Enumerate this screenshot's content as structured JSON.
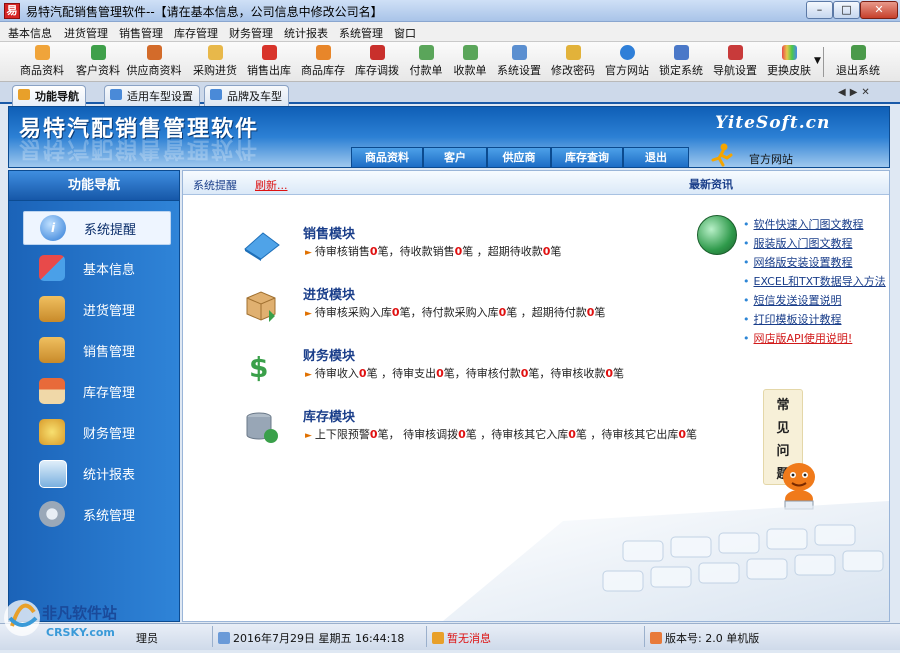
{
  "window": {
    "title": "易特汽配销售管理软件--【请在基本信息，公司信息中修改公司名】",
    "icon_letter": "易",
    "minimize": "–",
    "maximize": "□",
    "close": "✕"
  },
  "menu": [
    "基本信息",
    "进货管理",
    "销售管理",
    "库存管理",
    "财务管理",
    "统计报表",
    "系统管理",
    "窗口"
  ],
  "toolbar": [
    {
      "label": "商品资料",
      "icon": "goods-icon",
      "color": "#f0a43a"
    },
    {
      "label": "客户资料",
      "icon": "customer-icon",
      "color": "#3fa04a"
    },
    {
      "label": "供应商资料",
      "icon": "supplier-icon",
      "color": "#d36b2a"
    },
    {
      "label": "采购进货",
      "icon": "purchase-icon",
      "color": "#e8b84a"
    },
    {
      "label": "销售出库",
      "icon": "sales-icon",
      "color": "#d8342b"
    },
    {
      "label": "商品库存",
      "icon": "inventory-icon",
      "color": "#e8862a"
    },
    {
      "label": "库存调拨",
      "icon": "transfer-icon",
      "color": "#c9302c"
    },
    {
      "label": "付款单",
      "icon": "payment-icon",
      "color": "#5aa55a"
    },
    {
      "label": "收款单",
      "icon": "receipt-icon",
      "color": "#5aa55a"
    },
    {
      "label": "系统设置",
      "icon": "settings-icon",
      "color": "#5b8fd0"
    },
    {
      "label": "修改密码",
      "icon": "password-icon",
      "color": "#e2b23a"
    },
    {
      "label": "官方网站",
      "icon": "web-icon",
      "color": "#2f7fd8"
    },
    {
      "label": "锁定系统",
      "icon": "lock-icon",
      "color": "#4a78c8"
    },
    {
      "label": "导航设置",
      "icon": "nav-settings-icon",
      "color": "#c83a3a"
    },
    {
      "label": "更换皮肤",
      "icon": "skin-icon",
      "color": "#b84ac8"
    },
    {
      "label": "退出系统",
      "icon": "exit-icon",
      "color": "#4a9a4a"
    }
  ],
  "tabs": [
    {
      "label": "功能导航",
      "active": true
    },
    {
      "label": "适用车型设置",
      "active": false
    },
    {
      "label": "品牌及车型",
      "active": false
    }
  ],
  "tab_nav": "◀▶✕",
  "banner": {
    "title": "易特汽配销售管理软件",
    "site": "YiteSoft.cn",
    "nav": [
      "商品资料",
      "客户",
      "供应商",
      "库存查询",
      "退出"
    ],
    "official": "官方网站"
  },
  "left_nav": {
    "title": "功能导航",
    "items": [
      {
        "label": "系统提醒",
        "icon": "info-icon",
        "color": "#2d7ad6",
        "selected": true
      },
      {
        "label": "基本信息",
        "icon": "cubes-icon",
        "color": "#d84a4a",
        "selected": false
      },
      {
        "label": "进货管理",
        "icon": "box-in-icon",
        "color": "#e8a83a",
        "selected": false
      },
      {
        "label": "销售管理",
        "icon": "box-out-icon",
        "color": "#e8a83a",
        "selected": false
      },
      {
        "label": "库存管理",
        "icon": "house-icon",
        "color": "#e87a3a",
        "selected": false
      },
      {
        "label": "财务管理",
        "icon": "coins-icon",
        "color": "#e8b83a",
        "selected": false
      },
      {
        "label": "统计报表",
        "icon": "chart-icon",
        "color": "#6aa0d8",
        "selected": false
      },
      {
        "label": "系统管理",
        "icon": "gears-icon",
        "color": "#9aa8b8",
        "selected": false
      }
    ]
  },
  "content": {
    "reminder": "系统提醒",
    "refresh": "刷新...",
    "news_title": "最新资讯",
    "modules": [
      {
        "title": "销售模块",
        "icon": "book-icon",
        "color": "#4fa3e8",
        "line": "待审核销售0笔，待收款销售0笔 ，超期待收款0笔"
      },
      {
        "title": "进货模块",
        "icon": "package-icon",
        "color": "#d9a65a",
        "line": "待审核采购入库0笔，待付款采购入库0笔 ，超期待付款0笔"
      },
      {
        "title": "财务模块",
        "icon": "money-icon",
        "color": "#3aa04a",
        "line": "待审收入0笔 ，待审支出0笔，待审核付款0笔，待审核收款0笔"
      },
      {
        "title": "库存模块",
        "icon": "database-icon",
        "color": "#8a98a8",
        "line": "上下限预警0笔， 待审核调拨0笔 ，待审核其它入库0笔 ，待审核其它出库0笔"
      }
    ],
    "news": [
      {
        "text": "软件快速入门图文教程",
        "color": "#1a3e8a"
      },
      {
        "text": "服装版入门图文教程",
        "color": "#1a3e8a"
      },
      {
        "text": "网络版安装设置教程",
        "color": "#1a3e8a"
      },
      {
        "text": "EXCEL和TXT数据导入方法",
        "color": "#1a3e8a"
      },
      {
        "text": "短信发送设置说明",
        "color": "#1a3e8a"
      },
      {
        "text": "打印模板设计教程",
        "color": "#1a3e8a"
      },
      {
        "text": "网店版API使用说明!",
        "color": "#d11a1a"
      }
    ],
    "faq": [
      "常",
      "见",
      "问",
      "题"
    ]
  },
  "status": {
    "user": "理员",
    "datetime": "2016年7月29日   星期五    16:44:18",
    "message": "暂无消息",
    "version": "版本号: 2.0 单机版"
  },
  "watermark": {
    "text1": "非凡软件站",
    "text2": "CRSKY.com"
  }
}
